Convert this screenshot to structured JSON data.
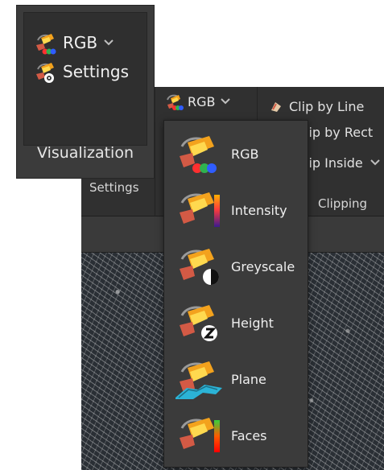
{
  "top_panel": {
    "rows": [
      {
        "label": "RGB"
      },
      {
        "label": "Settings"
      }
    ],
    "caption": "Visualization"
  },
  "ribbon": {
    "rgb_button_label": "RGB",
    "settings_label": "Settings",
    "clipping_label": "Clipping",
    "right_items": [
      {
        "label": "Clip by Line"
      },
      {
        "label": "lip by Rect"
      },
      {
        "label": "lip Inside"
      }
    ]
  },
  "dropdown": {
    "items": [
      {
        "label": "RGB"
      },
      {
        "label": "Intensity"
      },
      {
        "label": "Greyscale"
      },
      {
        "label": "Height"
      },
      {
        "label": "Plane"
      },
      {
        "label": "Faces"
      }
    ]
  },
  "colors": {
    "panel_bg": "#3b3b3b",
    "panel_inner": "#2f2f2f",
    "text": "#efefef",
    "accent_orange": "#f3a21d",
    "accent_yellow": "#ffd94f"
  },
  "icons": {
    "paint": "paint-bucket-brush-icon",
    "settings": "settings-gear-icon",
    "chevron": "chevron-down-icon",
    "clip": "clip-icon"
  }
}
